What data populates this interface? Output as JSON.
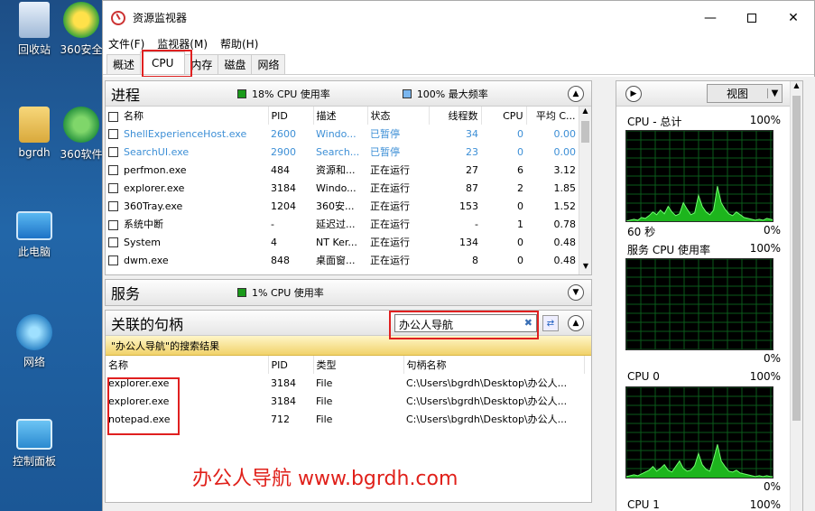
{
  "desktop": {
    "icons": [
      {
        "label": "回收站",
        "icon": "recycle-bin-icon"
      },
      {
        "label": "360安全",
        "icon": "360-security-icon"
      },
      {
        "label": "bgrdh",
        "icon": "user-folder-icon"
      },
      {
        "label": "360软件",
        "icon": "360-software-icon"
      },
      {
        "label": "此电脑",
        "icon": "computer-icon"
      },
      {
        "label": "网络",
        "icon": "network-icon"
      },
      {
        "label": "控制面板",
        "icon": "control-panel-icon"
      }
    ]
  },
  "window": {
    "title": "资源监视器",
    "menu": [
      "文件(F)",
      "监视器(M)",
      "帮助(H)"
    ],
    "tabs": [
      "概述",
      "CPU",
      "内存",
      "磁盘",
      "网络"
    ],
    "active_tab": "CPU"
  },
  "processes": {
    "title": "进程",
    "indicator1": "18% CPU 使用率",
    "indicator2": "100% 最大频率",
    "indicator1_color": "#1a9a1a",
    "indicator2_color": "#7ab6ef",
    "columns": [
      "名称",
      "PID",
      "描述",
      "状态",
      "线程数",
      "CPU",
      "平均 C..."
    ],
    "rows": [
      {
        "name": "ShellExperienceHost.exe",
        "pid": "2600",
        "desc": "Windo...",
        "status": "已暂停",
        "threads": "34",
        "cpu": "0",
        "avg": "0.00",
        "suspended": true
      },
      {
        "name": "SearchUI.exe",
        "pid": "2900",
        "desc": "Search...",
        "status": "已暂停",
        "threads": "23",
        "cpu": "0",
        "avg": "0.00",
        "suspended": true
      },
      {
        "name": "perfmon.exe",
        "pid": "484",
        "desc": "资源和...",
        "status": "正在运行",
        "threads": "27",
        "cpu": "6",
        "avg": "3.12",
        "suspended": false
      },
      {
        "name": "explorer.exe",
        "pid": "3184",
        "desc": "Windo...",
        "status": "正在运行",
        "threads": "87",
        "cpu": "2",
        "avg": "1.85",
        "suspended": false
      },
      {
        "name": "360Tray.exe",
        "pid": "1204",
        "desc": "360安...",
        "status": "正在运行",
        "threads": "153",
        "cpu": "0",
        "avg": "1.52",
        "suspended": false
      },
      {
        "name": "系统中断",
        "pid": "-",
        "desc": "延迟过...",
        "status": "正在运行",
        "threads": "-",
        "cpu": "1",
        "avg": "0.78",
        "suspended": false
      },
      {
        "name": "System",
        "pid": "4",
        "desc": "NT Ker...",
        "status": "正在运行",
        "threads": "134",
        "cpu": "0",
        "avg": "0.48",
        "suspended": false
      },
      {
        "name": "dwm.exe",
        "pid": "848",
        "desc": "桌面窗...",
        "status": "正在运行",
        "threads": "8",
        "cpu": "0",
        "avg": "0.48",
        "suspended": false
      }
    ]
  },
  "services": {
    "title": "服务",
    "indicator": "1% CPU 使用率",
    "indicator_color": "#1a9a1a"
  },
  "handles": {
    "title": "关联的句柄",
    "search_value": "办公人导航",
    "result_caption": "\"办公人导航\"的搜索结果",
    "columns": [
      "名称",
      "PID",
      "类型",
      "句柄名称"
    ],
    "rows": [
      {
        "name": "explorer.exe",
        "pid": "3184",
        "type": "File",
        "handle": "C:\\Users\\bgrdh\\Desktop\\办公人..."
      },
      {
        "name": "explorer.exe",
        "pid": "3184",
        "type": "File",
        "handle": "C:\\Users\\bgrdh\\Desktop\\办公人..."
      },
      {
        "name": "notepad.exe",
        "pid": "712",
        "type": "File",
        "handle": "C:\\Users\\bgrdh\\Desktop\\办公人..."
      }
    ]
  },
  "watermark": "办公人导航  www.bgrdh.com",
  "graphs": {
    "view_label": "视图",
    "items": [
      {
        "title": "CPU - 总计",
        "max": "100%",
        "min": "0%",
        "footer": "60 秒"
      },
      {
        "title": "服务 CPU 使用率",
        "max": "100%",
        "min": "0%"
      },
      {
        "title": "CPU 0",
        "max": "100%",
        "min": "0%"
      },
      {
        "title": "CPU 1",
        "max": "100%"
      }
    ],
    "cpu_total_series": [
      2,
      3,
      4,
      3,
      6,
      5,
      8,
      12,
      9,
      14,
      10,
      18,
      12,
      8,
      10,
      22,
      15,
      9,
      11,
      30,
      18,
      12,
      9,
      14,
      40,
      22,
      15,
      10,
      8,
      12,
      9,
      6,
      5,
      4,
      3,
      4,
      3,
      5,
      4,
      3
    ],
    "services_series": [
      0,
      0,
      0,
      0,
      0,
      0,
      1,
      0,
      0,
      0,
      1,
      0,
      0,
      0,
      0,
      1,
      0,
      0,
      0,
      0,
      0,
      0,
      0,
      0,
      1,
      0,
      0,
      0,
      0,
      0,
      0,
      0,
      0,
      0,
      0,
      0,
      0,
      0,
      0,
      0
    ],
    "cpu0_series": [
      3,
      4,
      5,
      4,
      6,
      8,
      10,
      14,
      9,
      12,
      16,
      10,
      8,
      14,
      20,
      12,
      9,
      10,
      15,
      28,
      16,
      11,
      9,
      22,
      38,
      20,
      14,
      9,
      8,
      10,
      7,
      6,
      5,
      4,
      3,
      4,
      3,
      4,
      3,
      3
    ]
  }
}
